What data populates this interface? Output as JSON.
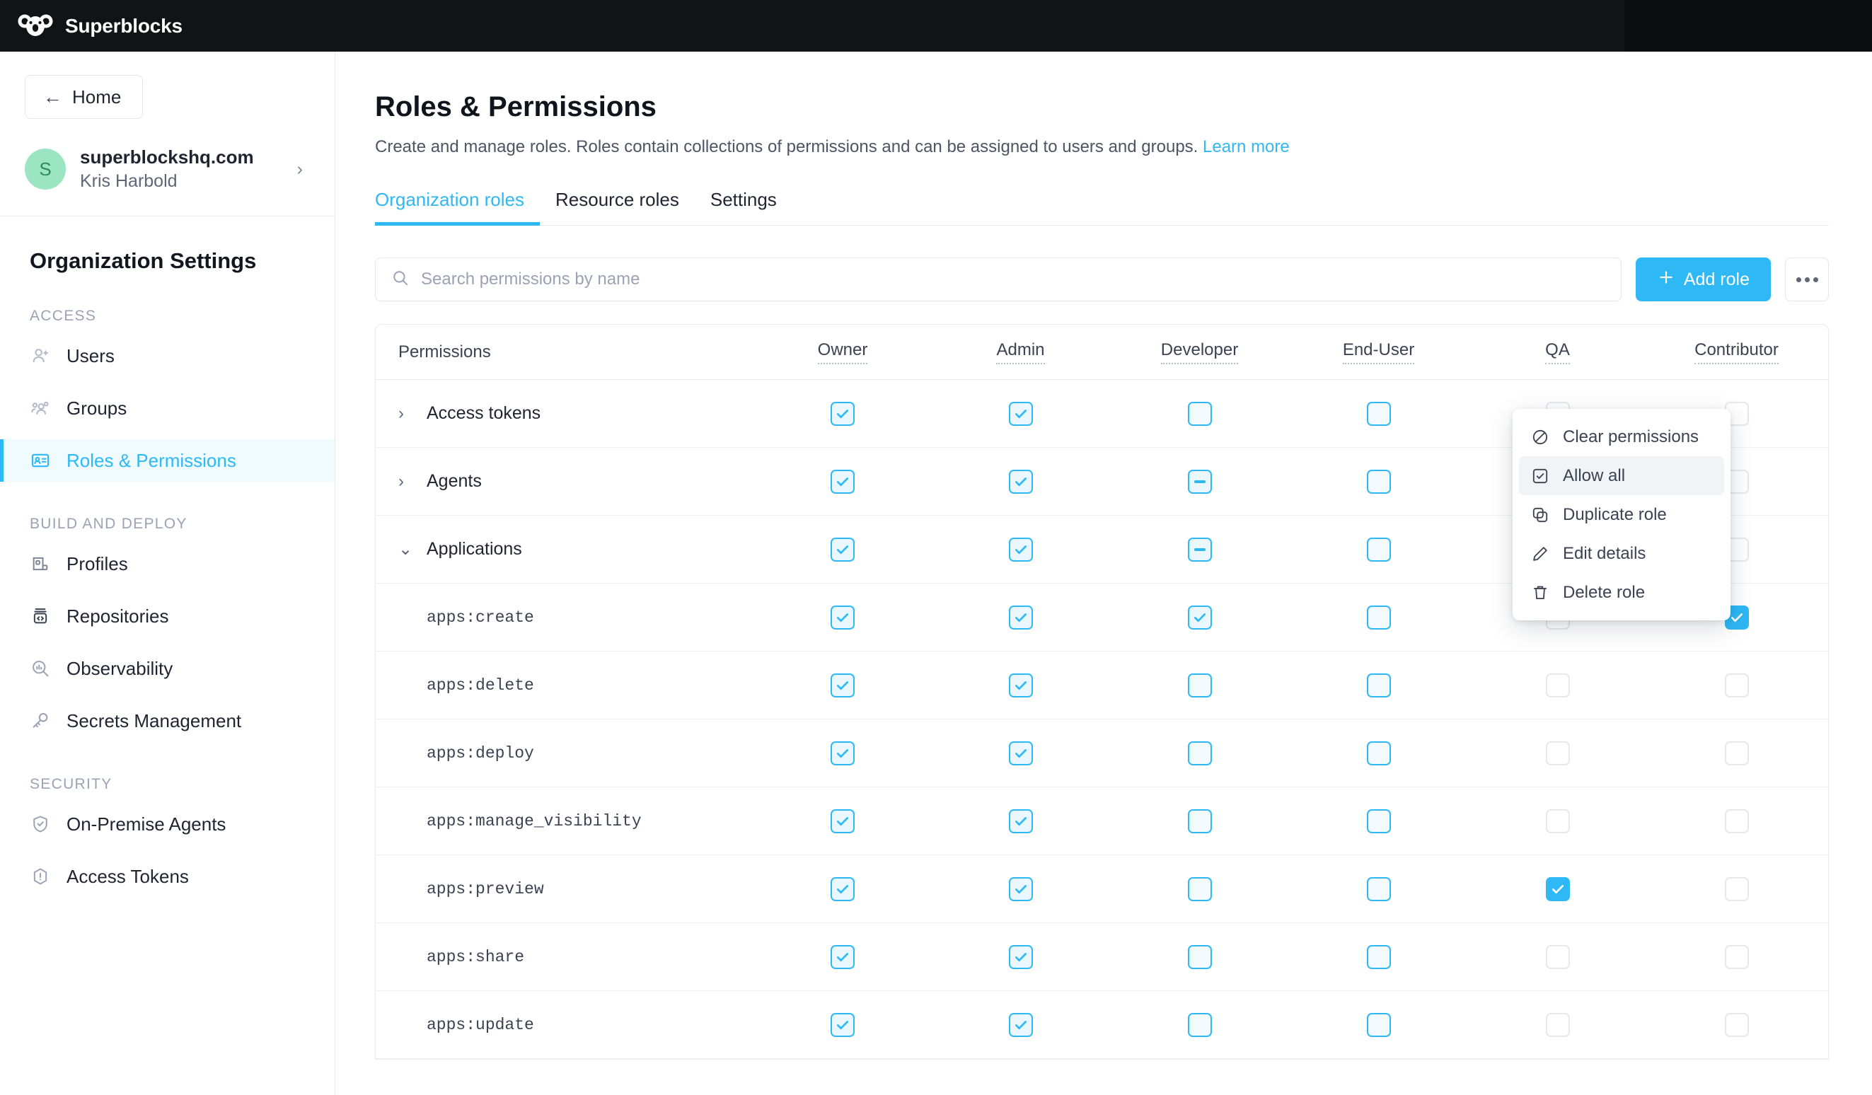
{
  "topbar": {
    "brand": "Superblocks",
    "logo_icon": "koala-logo-icon"
  },
  "sidebar": {
    "home_button": {
      "label": "Home",
      "icon": "arrow-left-icon"
    },
    "org": {
      "avatar_initial": "S",
      "domain": "superblockshq.com",
      "user": "Kris Harbold",
      "chevron_icon": "chevron-right-icon"
    },
    "settings_title": "Organization Settings",
    "groups": [
      {
        "label": "ACCESS",
        "items": [
          {
            "label": "Users",
            "icon": "user-plus-icon",
            "active": false
          },
          {
            "label": "Groups",
            "icon": "users-group-icon",
            "active": false
          },
          {
            "label": "Roles & Permissions",
            "icon": "id-card-icon",
            "active": true
          }
        ]
      },
      {
        "label": "BUILD AND DEPLOY",
        "items": [
          {
            "label": "Profiles",
            "icon": "profiles-icon",
            "active": false
          },
          {
            "label": "Repositories",
            "icon": "repository-icon",
            "active": false
          },
          {
            "label": "Observability",
            "icon": "observability-icon",
            "active": false
          },
          {
            "label": "Secrets Management",
            "icon": "key-icon",
            "active": false
          }
        ]
      },
      {
        "label": "SECURITY",
        "items": [
          {
            "label": "On-Premise Agents",
            "icon": "shield-check-icon",
            "active": false
          },
          {
            "label": "Access Tokens",
            "icon": "hexagon-alert-icon",
            "active": false
          }
        ]
      }
    ]
  },
  "main": {
    "title": "Roles & Permissions",
    "description": "Create and manage roles. Roles contain collections of permissions and can be assigned to users and groups.",
    "learn_more": "Learn more",
    "tabs": [
      {
        "label": "Organization roles",
        "active": true
      },
      {
        "label": "Resource roles",
        "active": false
      },
      {
        "label": "Settings",
        "active": false
      }
    ],
    "search": {
      "placeholder": "Search permissions by name",
      "value": "",
      "icon": "search-icon"
    },
    "add_role_button": {
      "label": "Add role",
      "icon": "plus-icon"
    },
    "kebab_button": {
      "icon": "more-horizontal-icon"
    }
  },
  "table": {
    "columns": [
      "Permissions",
      "Owner",
      "Admin",
      "Developer",
      "End-User",
      "QA",
      "Contributor"
    ],
    "rows": [
      {
        "type": "group",
        "label": "Access tokens",
        "expanded": false,
        "states": [
          "checked",
          "checked",
          "unchecked",
          "unchecked",
          "disabled",
          "disabled"
        ]
      },
      {
        "type": "group",
        "label": "Agents",
        "expanded": false,
        "states": [
          "checked",
          "checked",
          "indeterminate",
          "unchecked",
          "disabled",
          "disabled"
        ]
      },
      {
        "type": "group",
        "label": "Applications",
        "expanded": true,
        "states": [
          "checked",
          "checked",
          "indeterminate",
          "unchecked",
          "solid-indeterminate",
          "disabled"
        ]
      },
      {
        "type": "permission",
        "label": "apps:create",
        "states": [
          "checked",
          "checked",
          "checked",
          "unchecked",
          "disabled",
          "solid-checked"
        ]
      },
      {
        "type": "permission",
        "label": "apps:delete",
        "states": [
          "checked",
          "checked",
          "unchecked",
          "unchecked",
          "disabled",
          "disabled"
        ]
      },
      {
        "type": "permission",
        "label": "apps:deploy",
        "states": [
          "checked",
          "checked",
          "unchecked",
          "unchecked",
          "disabled",
          "disabled"
        ]
      },
      {
        "type": "permission",
        "label": "apps:manage_visibility",
        "states": [
          "checked",
          "checked",
          "unchecked",
          "unchecked",
          "disabled",
          "disabled"
        ]
      },
      {
        "type": "permission",
        "label": "apps:preview",
        "states": [
          "checked",
          "checked",
          "unchecked",
          "unchecked",
          "solid-checked",
          "disabled"
        ]
      },
      {
        "type": "permission",
        "label": "apps:share",
        "states": [
          "checked",
          "checked",
          "unchecked",
          "unchecked",
          "disabled",
          "disabled"
        ]
      },
      {
        "type": "permission",
        "label": "apps:update",
        "states": [
          "checked",
          "checked",
          "unchecked",
          "unchecked",
          "disabled",
          "disabled"
        ]
      }
    ]
  },
  "menu": {
    "items": [
      {
        "label": "Clear permissions",
        "icon": "circle-slash-icon",
        "highlight": false
      },
      {
        "label": "Allow all",
        "icon": "checkbox-icon",
        "highlight": true
      },
      {
        "label": "Duplicate role",
        "icon": "copy-icon",
        "highlight": false
      },
      {
        "label": "Edit details",
        "icon": "pencil-icon",
        "highlight": false
      },
      {
        "label": "Delete role",
        "icon": "trash-icon",
        "highlight": false
      }
    ]
  },
  "colors": {
    "accent": "#2eb8f5",
    "topbar_bg": "#111317",
    "avatar_bg": "#9be5c2",
    "active_nav_bg": "#effbff"
  }
}
